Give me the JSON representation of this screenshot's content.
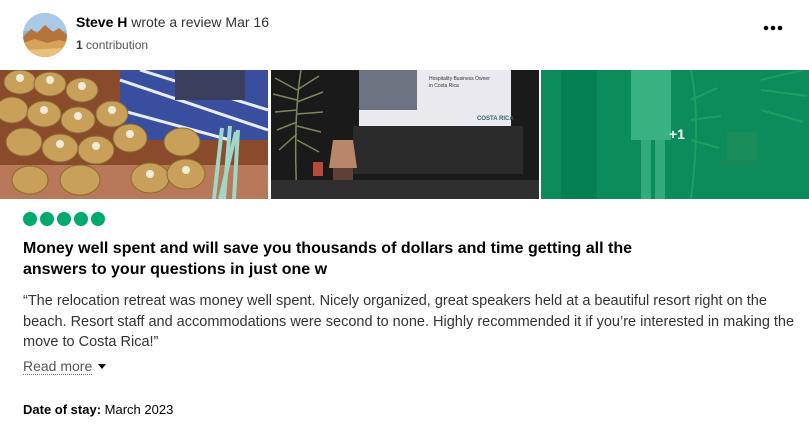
{
  "review": {
    "reviewer_name": "Steve H",
    "action_text": "wrote a review",
    "date": "Mar 16",
    "contribution_count": "1",
    "contribution_label": "contribution",
    "more_icon": "more-dots-icon",
    "rating_bubbles": 5,
    "title": "Money well spent and will save you thousands of dollars and time getting all the answers to your questions in just one w",
    "body": "“The relocation retreat was money well spent. Nicely organized, great speakers held at a beautiful resort right on the beach. Resort staff and accommodations were second to none. Highly recommended it if you’re interested in making the move to Costa Rica!”",
    "read_more_label": "Read more",
    "stay_label": "Date of stay:",
    "stay_value": "March 2023"
  },
  "photos": {
    "extra_count_label": "+1",
    "slide_text_line1": "Hospitality Business Owner",
    "slide_text_line2": "in Costa Rica",
    "slide_logo": "COSTA RICA"
  },
  "colors": {
    "brand_green": "#00aa6c",
    "text_primary": "#000000",
    "text_secondary": "#555555"
  }
}
